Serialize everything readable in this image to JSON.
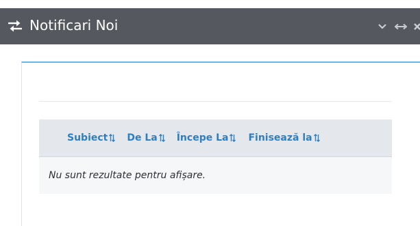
{
  "window": {
    "title": "Notificari Noi",
    "icons": {
      "title_icon": "swap-arrows-icon",
      "collapse": "chevron-down-icon",
      "resize": "horizontal-resize-icon",
      "close": "close-icon"
    }
  },
  "table": {
    "columns": [
      {
        "label": "Subiect",
        "sort_icon": "sort-icon"
      },
      {
        "label": "De La",
        "sort_icon": "sort-icon"
      },
      {
        "label": "Începe La",
        "sort_icon": "sort-icon"
      },
      {
        "label": "Finisează la",
        "sort_icon": "sort-icon"
      }
    ],
    "empty_message": "Nu sunt rezultate pentru afișare."
  },
  "colors": {
    "titlebar_bg": "#55585f",
    "header_text": "#2d7fc1",
    "panel_accent": "#6cb7e6",
    "table_header_bg": "#e4e7eb",
    "row_bg": "#f6f7f8"
  }
}
